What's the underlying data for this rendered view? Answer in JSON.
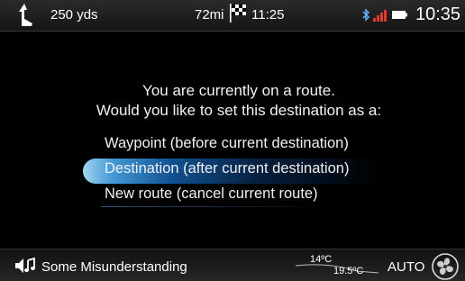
{
  "status_bar": {
    "turn_distance": "250 yds",
    "range": "72mi",
    "eta": "11:25",
    "clock": "10:35",
    "icons": [
      "turn-arrow-icon",
      "checkered-flag-icon",
      "bluetooth-icon",
      "signal-strength-icon",
      "battery-icon"
    ]
  },
  "dialog": {
    "line1": "You are currently on a route.",
    "line2": "Would you like to set this destination as a:",
    "options": [
      {
        "label": "Waypoint (before current destination)",
        "selected": false
      },
      {
        "label": "Destination (after current destination)",
        "selected": true
      },
      {
        "label": "New route (cancel current route)",
        "selected": false
      }
    ],
    "highlight_color": "#1e7fd0"
  },
  "bottom_bar": {
    "track": "Some Misunderstanding",
    "temp_left": "14ºC",
    "temp_right": "19.5ºC",
    "climate_mode": "AUTO",
    "icons": [
      "speaker-music-icon",
      "fan-icon"
    ]
  }
}
